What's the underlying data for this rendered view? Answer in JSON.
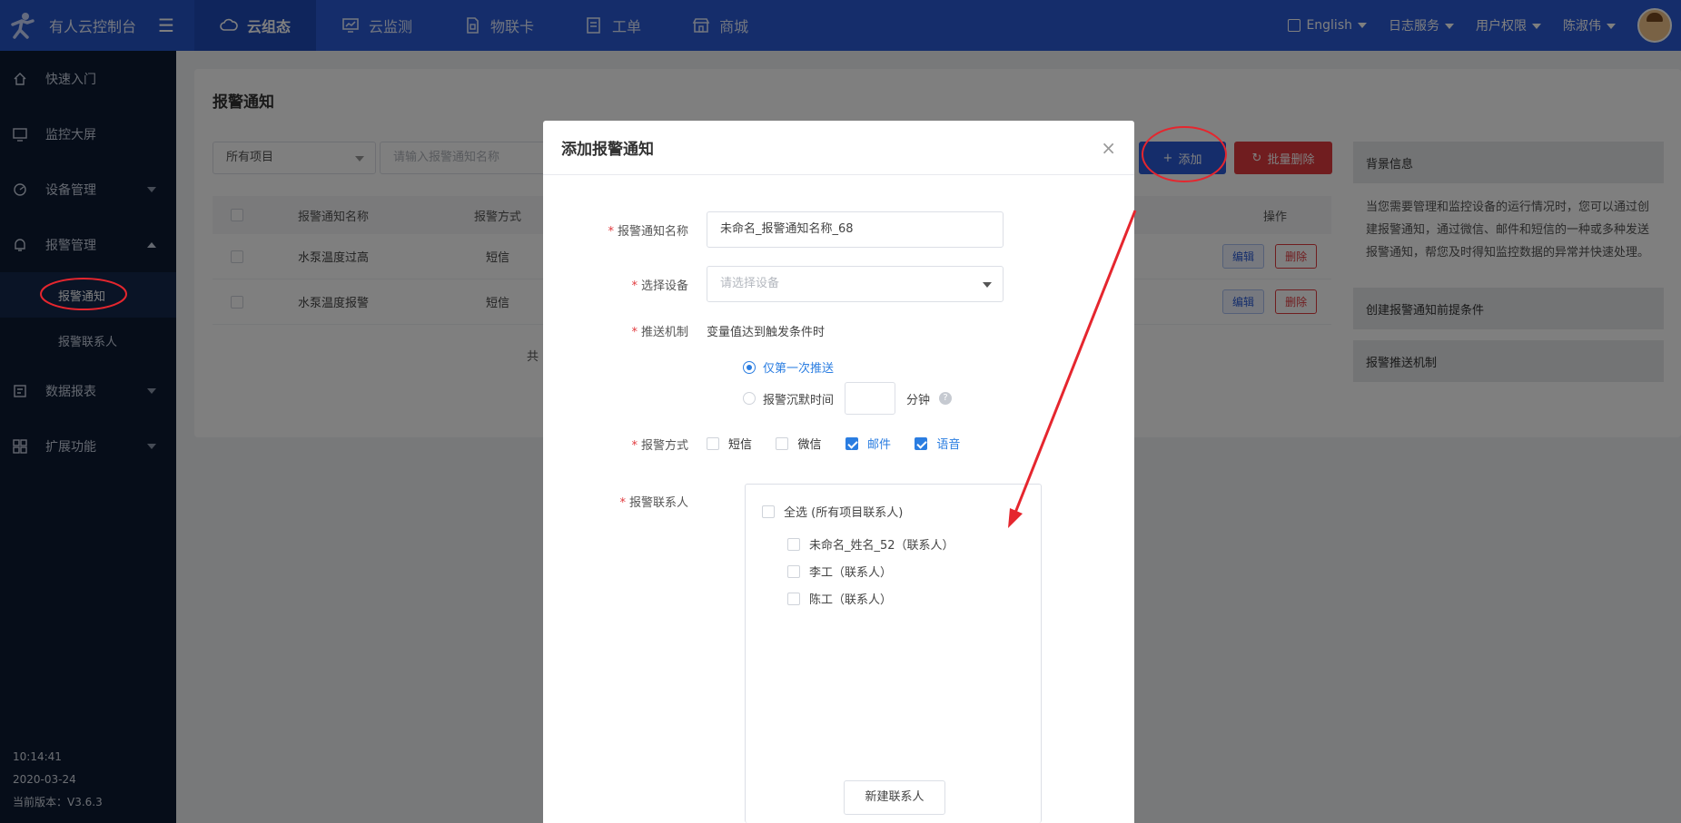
{
  "topbar": {
    "brand": "有人云控制台",
    "nav": [
      {
        "label": "云组态",
        "icon": "cloud-icon",
        "active": true
      },
      {
        "label": "云监测",
        "icon": "monitor-icon",
        "active": false
      },
      {
        "label": "物联卡",
        "icon": "sim-card-icon",
        "active": false
      },
      {
        "label": "工单",
        "icon": "ticket-icon",
        "active": false
      },
      {
        "label": "商城",
        "icon": "store-icon",
        "active": false
      }
    ],
    "language": "English",
    "log_service": "日志服务",
    "user_permission": "用户权限",
    "username": "陈淑伟"
  },
  "sidebar": {
    "items": [
      {
        "label": "快速入门",
        "icon": "home-icon"
      },
      {
        "label": "监控大屏",
        "icon": "screen-icon"
      },
      {
        "label": "设备管理",
        "icon": "device-icon"
      },
      {
        "label": "报警管理",
        "icon": "bell-icon"
      }
    ],
    "sub": [
      {
        "label": "报警通知",
        "active": true
      },
      {
        "label": "报警联系人",
        "active": false
      }
    ],
    "items2": [
      {
        "label": "数据报表",
        "icon": "report-icon"
      },
      {
        "label": "扩展功能",
        "icon": "extend-icon"
      }
    ],
    "time": "10:14:41",
    "date": "2020-03-24",
    "version": "当前版本：V3.6.3"
  },
  "main": {
    "title": "报警通知",
    "filter_select": "所有项目",
    "search_placeholder": "请输入报警通知名称",
    "add_button": "添加",
    "batch_delete_button": "批量删除",
    "columns": {
      "name": "报警通知名称",
      "way": "报警方式",
      "ops": "操作"
    },
    "rows": [
      {
        "name": "水泵温度过高",
        "way": "短信"
      },
      {
        "name": "水泵温度报警",
        "way": "短信"
      }
    ],
    "edit_label": "编辑",
    "delete_label": "删除",
    "pager": "共"
  },
  "info": {
    "background_title": "背景信息",
    "background_text": "当您需要管理和监控设备的运行情况时，您可以通过创建报警通知，通过微信、邮件和短信的一种或多种发送报警通知，帮您及时得知监控数据的异常并快速处理。",
    "section2": "创建报警通知前提条件",
    "section3": "报警推送机制"
  },
  "modal": {
    "title": "添加报警通知",
    "name_label": "报警通知名称",
    "name_value": "未命名_报警通知名称_68",
    "device_label": "选择设备",
    "device_placeholder": "请选择设备",
    "push_label": "推送机制",
    "push_text": "变量值达到触发条件时",
    "push_first": "仅第一次推送",
    "push_silence": "报警沉默时间",
    "minutes": "分钟",
    "method_label": "报警方式",
    "methods": [
      {
        "label": "短信",
        "checked": false
      },
      {
        "label": "微信",
        "checked": false
      },
      {
        "label": "邮件",
        "checked": true
      },
      {
        "label": "语音",
        "checked": true
      }
    ],
    "contact_label": "报警联系人",
    "select_all": "全选 (所有项目联系人)",
    "contacts": [
      "未命名_姓名_52（联系人）",
      "李工（联系人）",
      "陈工（联系人）"
    ],
    "new_contact": "新建联系人"
  },
  "colors": {
    "primary": "#2a5bd7",
    "danger": "#e13a3e",
    "sidebar": "#0c1a33",
    "annotation": "#e5262e"
  }
}
